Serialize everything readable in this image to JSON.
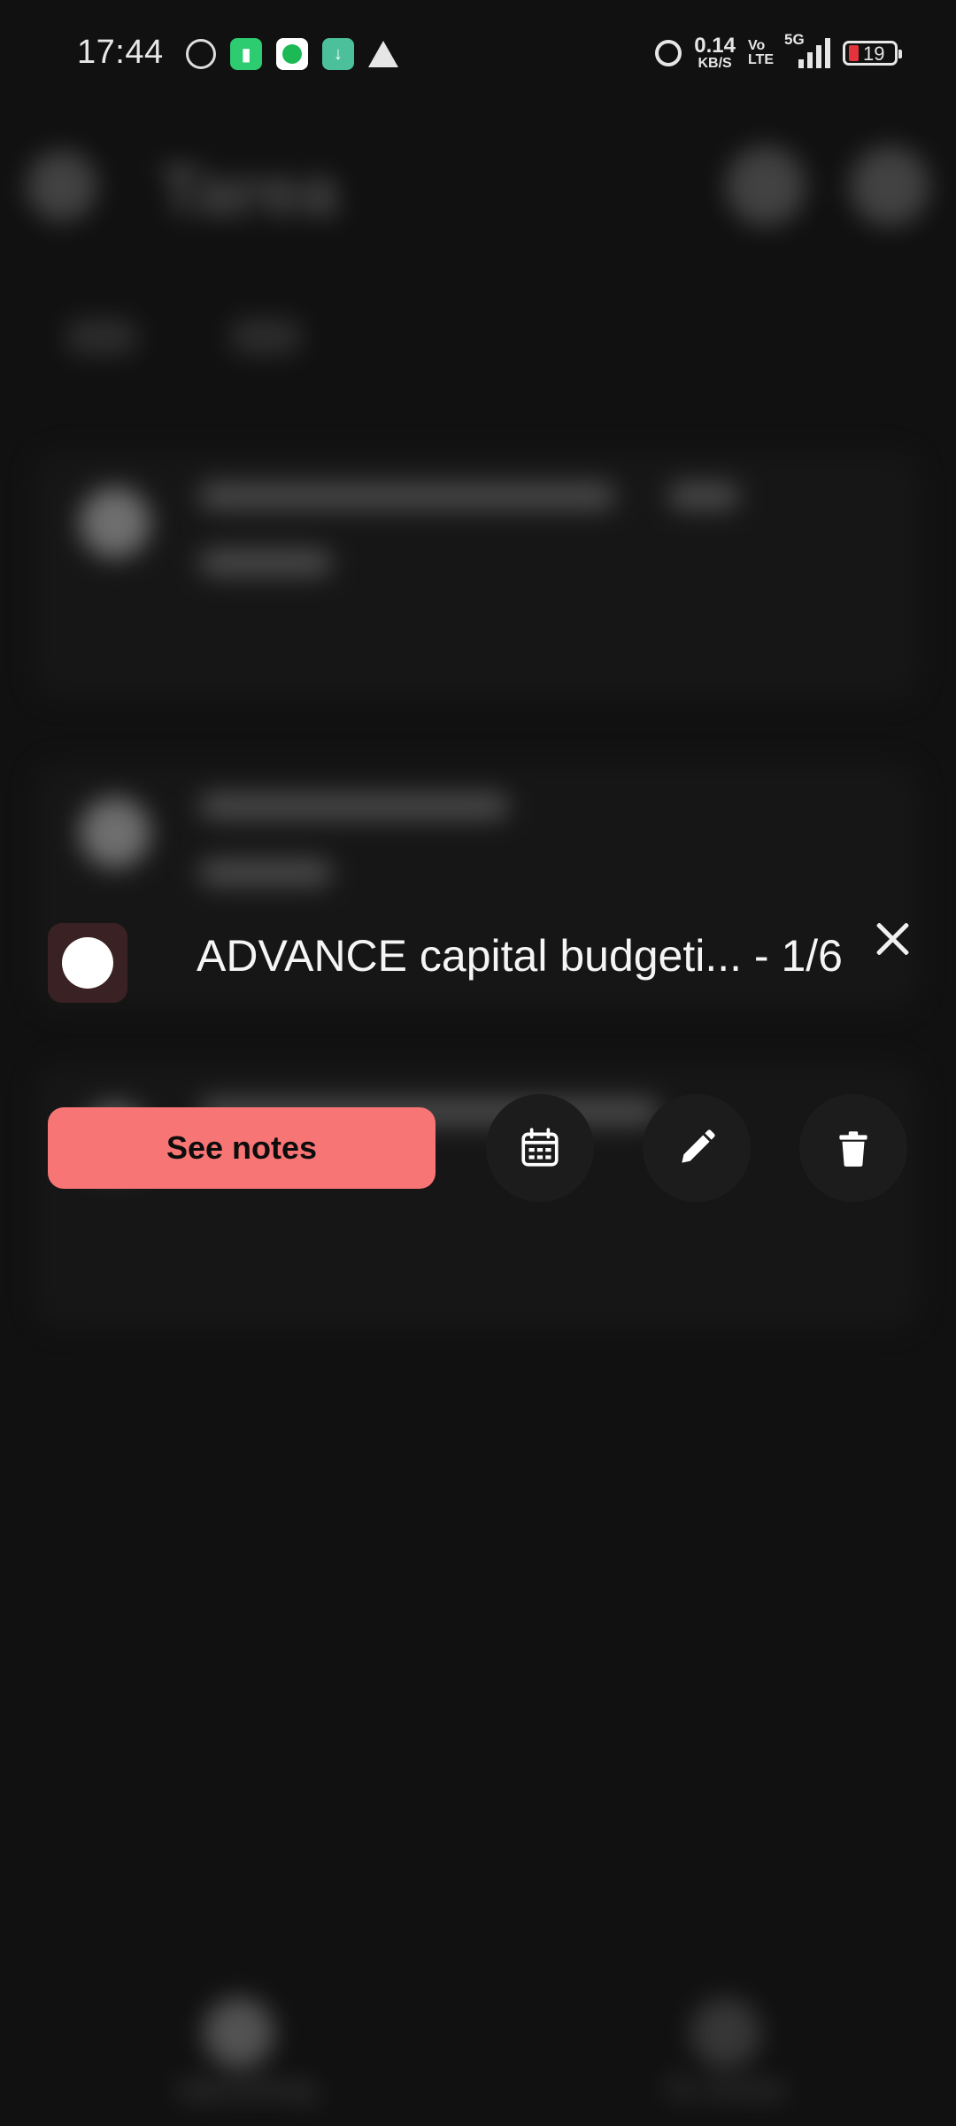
{
  "status_bar": {
    "time": "17:44",
    "net_speed_value": "0.14",
    "net_speed_unit": "KB/S",
    "volte_top": "Vo",
    "volte_bottom": "LTE",
    "network_type": "5G",
    "battery_level": "19",
    "notification_icons": [
      "whatsapp-icon",
      "battery-saver-icon",
      "spotify-icon",
      "download-icon",
      "warning-icon"
    ],
    "colors": {
      "battery_low": "#e5333d"
    }
  },
  "background_app": {
    "bottom_nav": {
      "upcoming_label": "Upcoming",
      "to_revise_label": "To revise"
    }
  },
  "task_sheet": {
    "title": "ADVANCE capital budgeti... - 1/6",
    "see_notes_label": "See notes",
    "actions": [
      "calendar-icon",
      "pencil-icon",
      "trash-icon"
    ],
    "colors": {
      "primary_button": "#f87575",
      "checkbox_bg": "#3a2224",
      "round_button_bg": "#1c1c1c"
    }
  }
}
